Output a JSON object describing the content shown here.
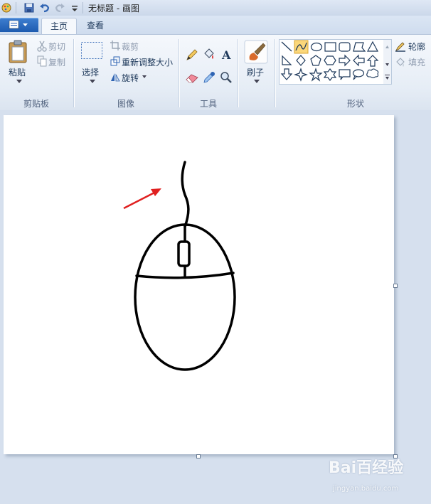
{
  "window": {
    "title": "无标题 - 画图"
  },
  "tabs": {
    "home": "主页",
    "view": "查看"
  },
  "clipboard": {
    "paste": "粘贴",
    "cut": "剪切",
    "copy": "复制",
    "group_label": "剪贴板"
  },
  "image": {
    "select": "选择",
    "crop": "裁剪",
    "resize": "重新调整大小",
    "rotate": "旋转",
    "group_label": "图像"
  },
  "tools": {
    "group_label": "工具"
  },
  "brushes": {
    "label": "刷子"
  },
  "shapes": {
    "outline": "轮廓",
    "fill": "填充",
    "group_label": "形状",
    "selected": "curve"
  },
  "colors": {
    "annotation_arrow": "#e02020",
    "drawing_stroke": "#000000",
    "ribbon_accent": "#1d5bb0"
  },
  "watermark": {
    "brand": "Bai百经验",
    "url": "jingyan.baidu.com"
  }
}
